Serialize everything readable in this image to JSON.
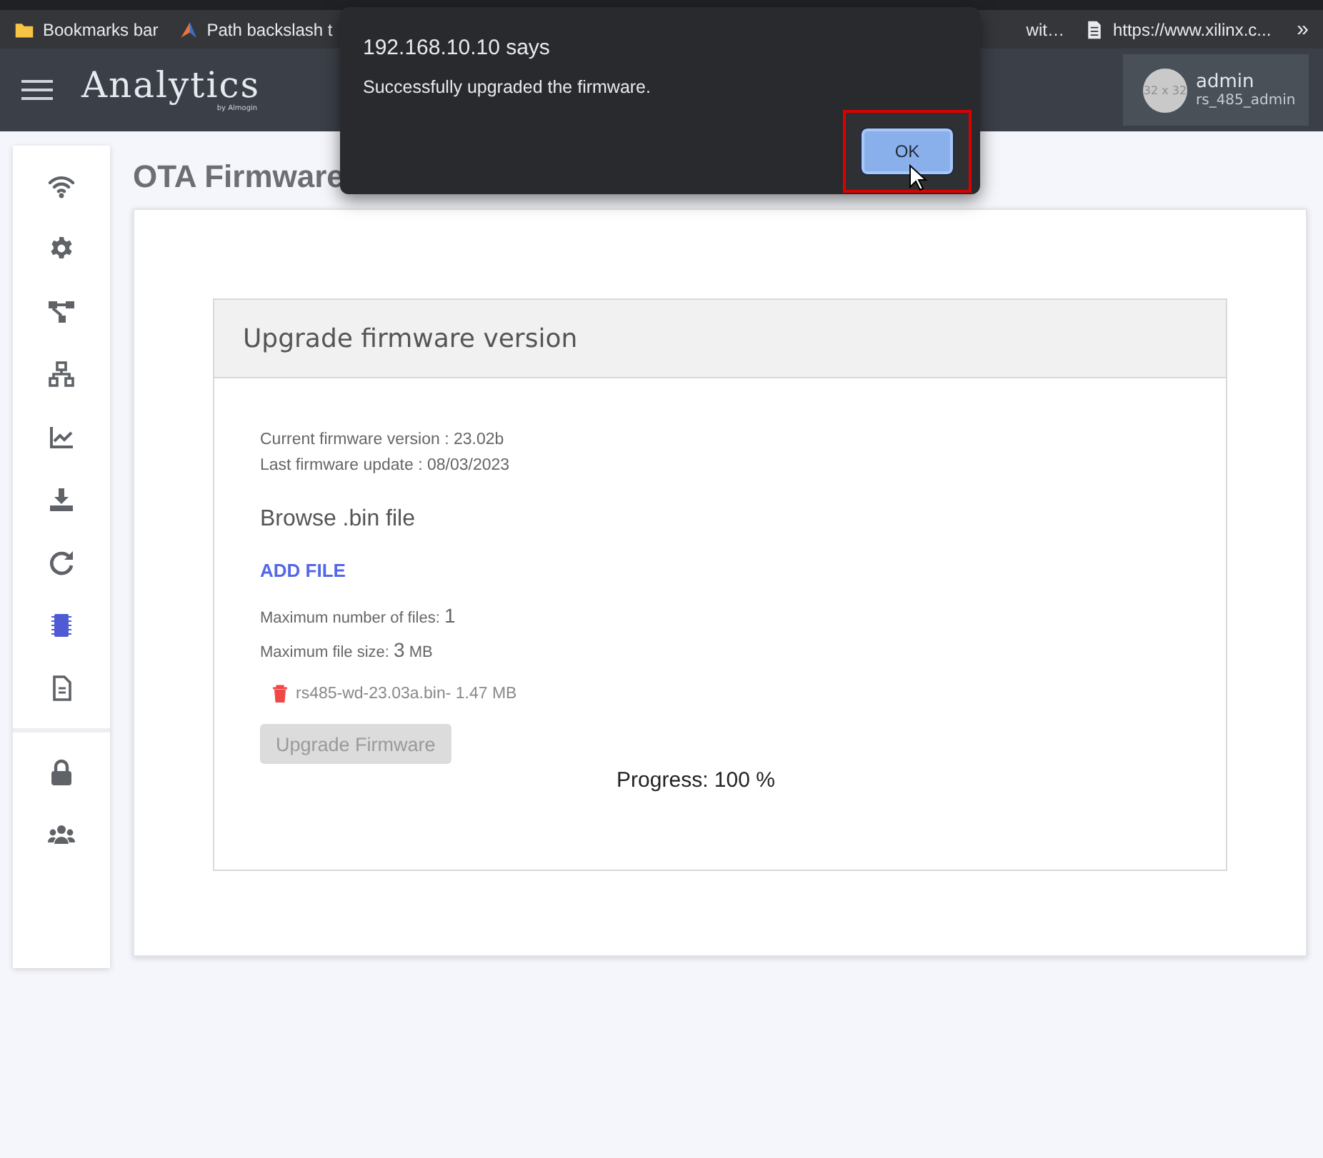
{
  "browser": {
    "bookmarks": [
      {
        "kind": "folder",
        "label": "Bookmarks bar"
      },
      {
        "kind": "site",
        "label": "Path backslash t"
      },
      {
        "kind": "site",
        "label": "wit…"
      },
      {
        "kind": "page",
        "label": "https://www.xilinx.c..."
      }
    ],
    "overflow": "»"
  },
  "header": {
    "logo": "Analytics",
    "logo_byline": "by Almogin",
    "avatar_placeholder": "32 x 32",
    "user": "admin",
    "role": "rs_485_admin"
  },
  "sidebar": {
    "items": [
      {
        "kind": "wifi",
        "selected": false
      },
      {
        "kind": "gear",
        "selected": false
      },
      {
        "kind": "flow",
        "selected": false
      },
      {
        "kind": "network",
        "selected": false
      },
      {
        "kind": "chart",
        "selected": false
      },
      {
        "kind": "download",
        "selected": false
      },
      {
        "kind": "refresh",
        "selected": false
      },
      {
        "kind": "chip",
        "selected": true
      },
      {
        "kind": "file",
        "selected": false
      }
    ],
    "bottom_items": [
      {
        "kind": "lock",
        "selected": false
      },
      {
        "kind": "users",
        "selected": false
      }
    ]
  },
  "page_title": "OTA Firmware",
  "panel": {
    "title": "Upgrade firmware version",
    "current_version": "Current firmware version : 23.02b",
    "last_update": "Last firmware update : 08/03/2023",
    "browse_heading": "Browse .bin file",
    "add_file": "ADD FILE",
    "max_files_label": "Maximum number of files:",
    "max_files_value": "1",
    "max_size_label": "Maximum file size:",
    "max_size_value": "3",
    "max_size_unit": "MB",
    "files": [
      {
        "name": "rs485-wd-23.03a.bin- 1.47 MB"
      }
    ],
    "upgrade_button": {
      "label": "Upgrade Firmware",
      "disabled": true
    },
    "progress": "Progress: 100 %"
  },
  "dialog": {
    "title": "192.168.10.10 says",
    "message": "Successfully upgraded the firmware.",
    "button": "OK",
    "highlighted": true
  }
}
